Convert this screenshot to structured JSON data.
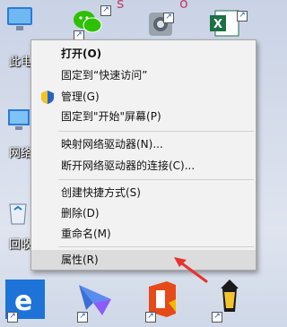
{
  "desktop": {
    "left_labels": [
      "此电",
      "网络",
      "回收"
    ],
    "status_icons": [
      "s-letter-icon",
      "o-letter-icon"
    ]
  },
  "context_menu": {
    "items": [
      {
        "label": "打开(O)",
        "bold": true
      },
      {
        "label": "固定到“快速访问”"
      },
      {
        "label": "管理(G)",
        "icon": "shield-icon"
      },
      {
        "label": "固定到\"开始\"屏幕(P)"
      },
      {
        "label": "映射网络驱动器(N)..."
      },
      {
        "label": "断开网络驱动器的连接(C)..."
      },
      {
        "label": "创建快捷方式(S)"
      },
      {
        "label": "删除(D)"
      },
      {
        "label": "重命名(M)"
      },
      {
        "label": "属性(R)",
        "highlighted": true
      }
    ]
  },
  "colors": {
    "menu_bg": "#f2f2f2",
    "highlight": "#dcdcdc",
    "annotation_arrow": "#e8322c"
  },
  "taskbar_icons": [
    "edge-icon",
    "feishu-icon",
    "office-icon",
    "lantern-icon"
  ]
}
